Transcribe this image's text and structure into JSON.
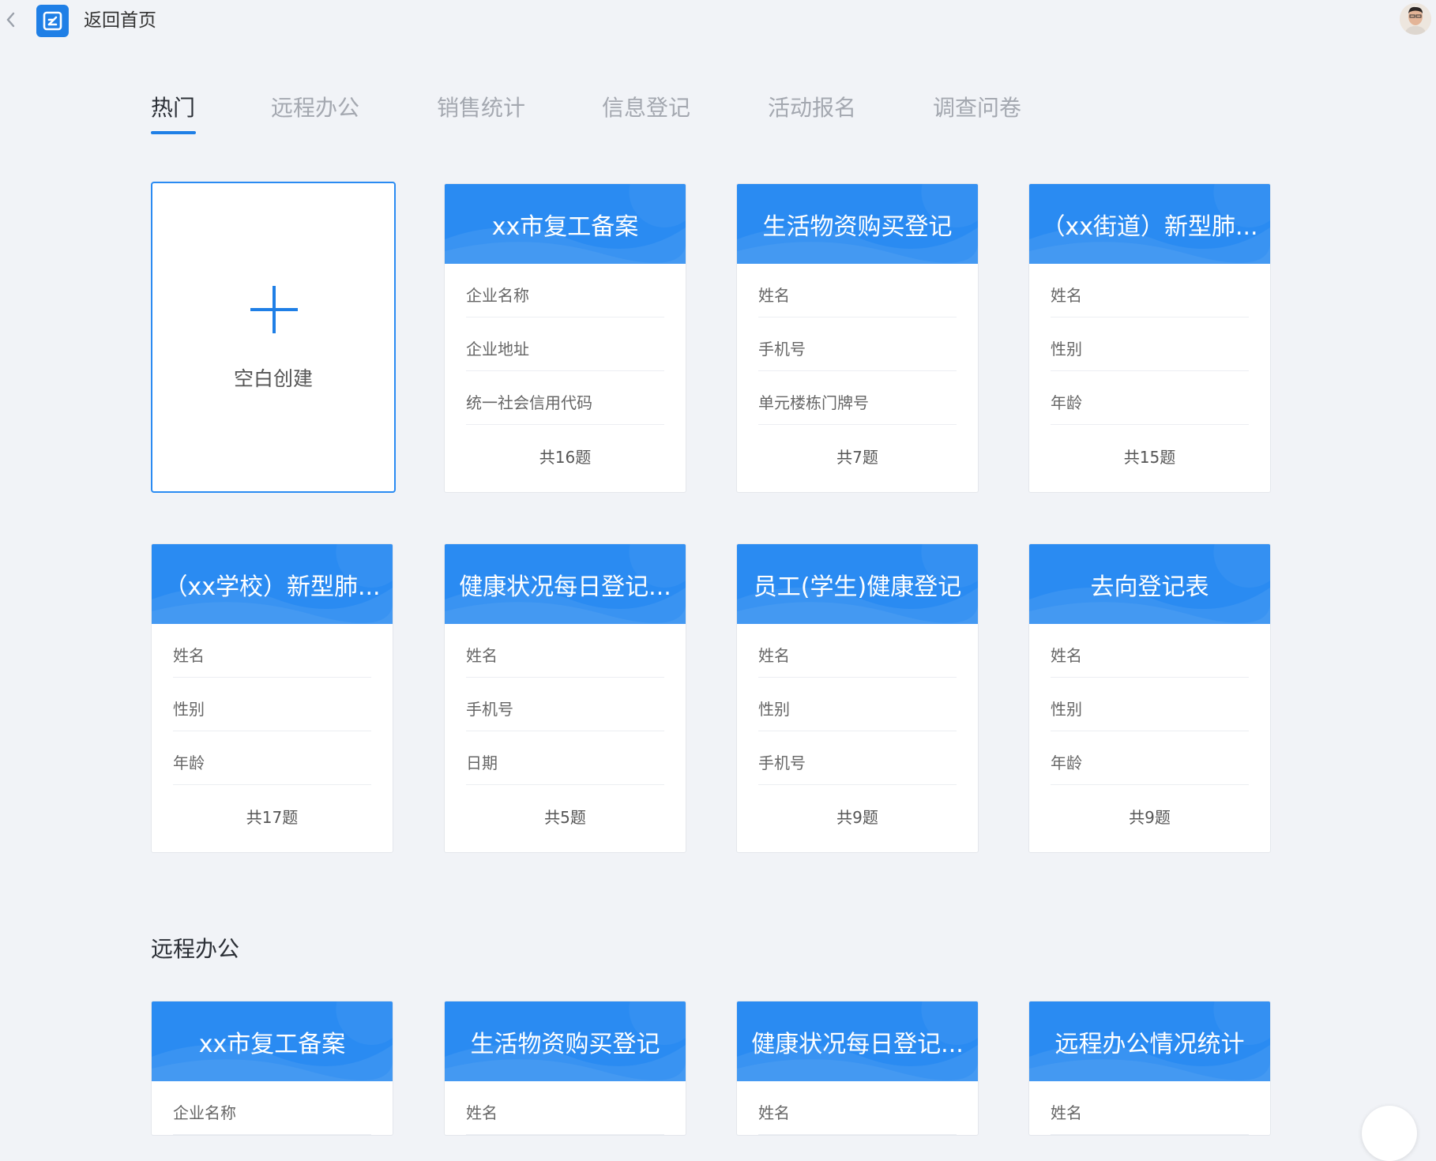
{
  "header": {
    "home_label": "返回首页"
  },
  "tabs": [
    {
      "label": "热门"
    },
    {
      "label": "远程办公"
    },
    {
      "label": "销售统计"
    },
    {
      "label": "信息登记"
    },
    {
      "label": "活动报名"
    },
    {
      "label": "调查问卷"
    }
  ],
  "blank": {
    "label": "空白创建"
  },
  "hot_cards": [
    {
      "title": "xx市复工备案",
      "fields": [
        "企业名称",
        "企业地址",
        "统一社会信用代码"
      ],
      "count": "共16题"
    },
    {
      "title": "生活物资购买登记",
      "fields": [
        "姓名",
        "手机号",
        "单元楼栋门牌号"
      ],
      "count": "共7题"
    },
    {
      "title": "（xx街道）新型肺...",
      "fields": [
        "姓名",
        "性别",
        "年龄"
      ],
      "count": "共15题"
    },
    {
      "title": "（xx学校）新型肺...",
      "fields": [
        "姓名",
        "性别",
        "年龄"
      ],
      "count": "共17题"
    },
    {
      "title": "健康状况每日登记...",
      "fields": [
        "姓名",
        "手机号",
        "日期"
      ],
      "count": "共5题"
    },
    {
      "title": "员工(学生)健康登记",
      "fields": [
        "姓名",
        "性别",
        "手机号"
      ],
      "count": "共9题"
    },
    {
      "title": "去向登记表",
      "fields": [
        "姓名",
        "性别",
        "年龄"
      ],
      "count": "共9题"
    }
  ],
  "section": {
    "title": "远程办公"
  },
  "remote_cards": [
    {
      "title": "xx市复工备案",
      "fields": [
        "企业名称"
      ]
    },
    {
      "title": "生活物资购买登记",
      "fields": [
        "姓名"
      ]
    },
    {
      "title": "健康状况每日登记...",
      "fields": [
        "姓名"
      ]
    },
    {
      "title": "远程办公情况统计",
      "fields": [
        "姓名"
      ]
    }
  ],
  "colors": {
    "accent": "#1f7fe6",
    "card_header": "#2a8bf2",
    "background": "#f1f3f7"
  },
  "icons": {
    "back": "chevron-left-icon",
    "logo": "form-edit-icon",
    "plus": "plus-icon"
  }
}
